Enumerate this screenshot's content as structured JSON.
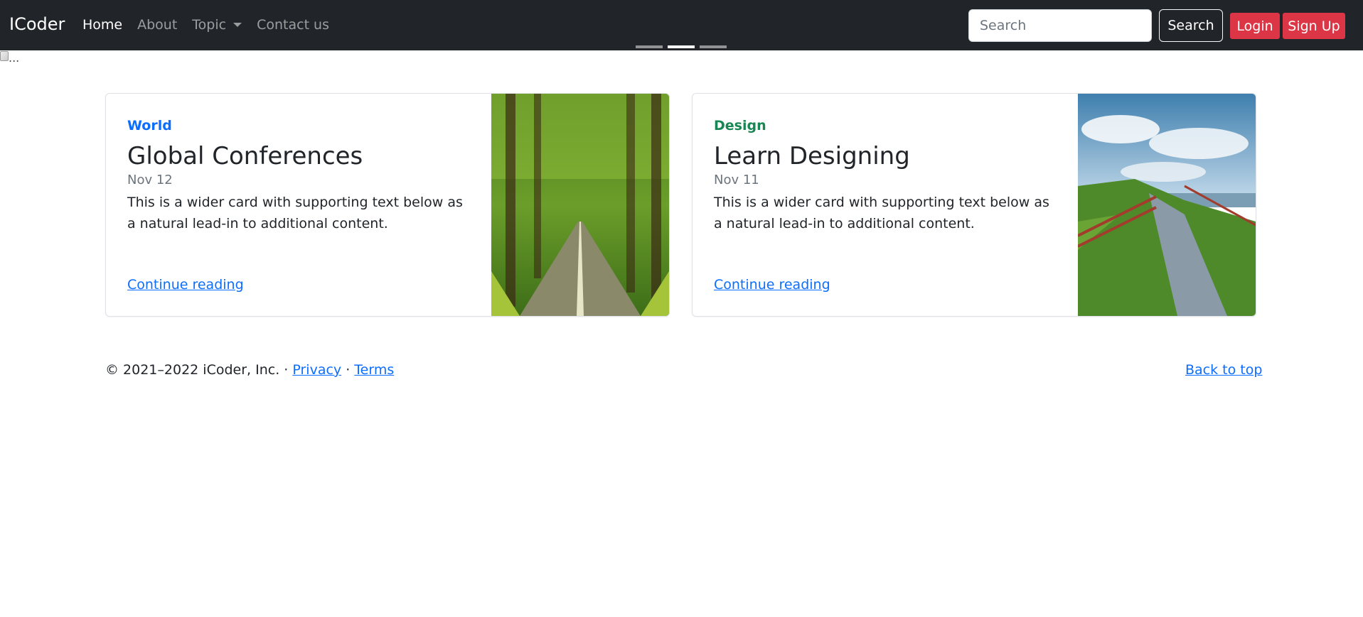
{
  "nav": {
    "brand": "ICoder",
    "links": [
      "Home",
      "About",
      "Topic",
      "Contact us"
    ],
    "search_placeholder": "Search",
    "search_button": "Search",
    "login": "Login",
    "signup": "Sign Up"
  },
  "carousel": {
    "indicators": 3,
    "active_index": 1
  },
  "broken_image_alt": "...",
  "cards": [
    {
      "category": "World",
      "title": "Global Conferences",
      "date": "Nov 12",
      "text": "This is a wider card with supporting text below as a natural lead-in to additional content.",
      "link": "Continue reading"
    },
    {
      "category": "Design",
      "title": "Learn Designing",
      "date": "Nov 11",
      "text": "This is a wider card with supporting text below as a natural lead-in to additional content.",
      "link": "Continue reading"
    }
  ],
  "footer": {
    "copyright": "© 2021–2022 iCoder, Inc. · ",
    "privacy": "Privacy",
    "separator": " · ",
    "terms": "Terms",
    "back_to_top": "Back to top"
  },
  "colors": {
    "navbar": "#212529",
    "primary": "#0d6efd",
    "success": "#198754",
    "danger": "#dc3545"
  }
}
